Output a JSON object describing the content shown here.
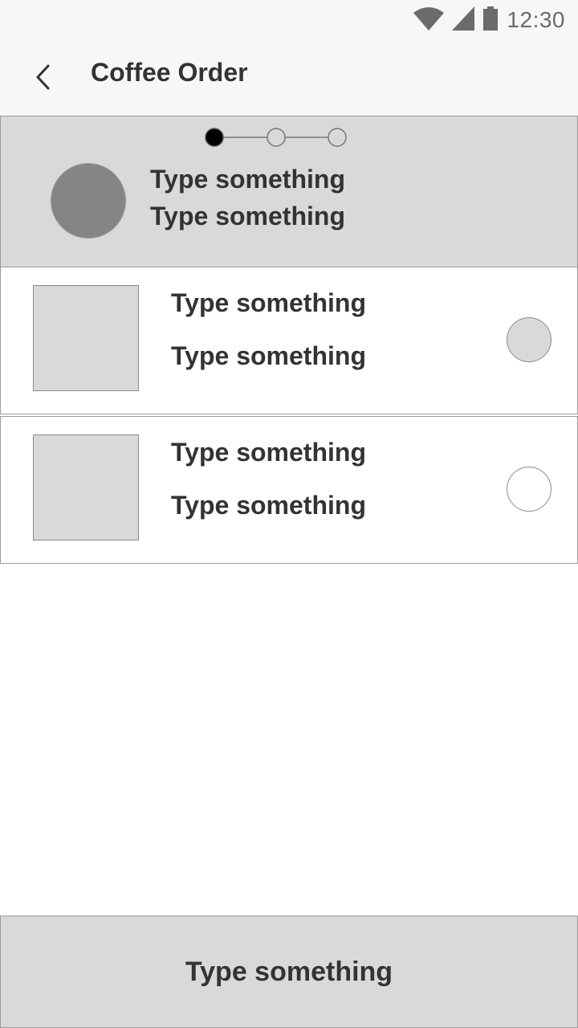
{
  "status_bar": {
    "time": "12:30",
    "icons": [
      "wifi-icon",
      "signal-icon",
      "battery-icon"
    ]
  },
  "app_bar": {
    "back_icon": "chevron-left-icon",
    "title": "Coffee Order"
  },
  "progress": {
    "steps_total": 3,
    "current_step": 1,
    "line1": "Type something",
    "line2": "Type something"
  },
  "items": [
    {
      "line1": "Type something",
      "line2": "Type something",
      "selected": true
    },
    {
      "line1": "Type something",
      "line2": "Type something",
      "selected": false
    }
  ],
  "bottom_button": {
    "label": "Type something"
  },
  "colors": {
    "placeholder_gray": "#d9d9d9",
    "avatar_gray": "#858585",
    "text": "#333333",
    "border": "#9a9a9a",
    "step_active": "#000000"
  }
}
